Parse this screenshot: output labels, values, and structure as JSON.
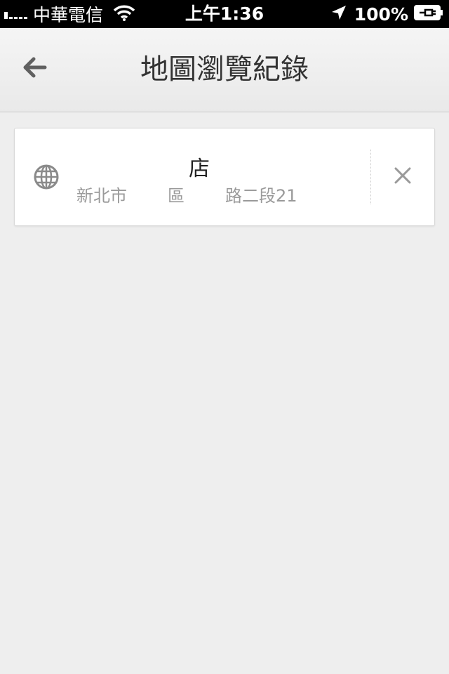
{
  "status_bar": {
    "carrier": "中華電信",
    "time": "上午1:36",
    "battery": "100%"
  },
  "header": {
    "title": "地圖瀏覽紀錄"
  },
  "history": [
    {
      "name": "店",
      "address_parts": [
        "新北市",
        "區",
        "路二段21"
      ]
    }
  ],
  "icons": {
    "back": "arrow-back-icon",
    "globe": "globe-icon",
    "delete": "close-icon",
    "wifi": "wifi-icon",
    "location": "location-arrow-icon",
    "battery": "battery-charging-icon"
  }
}
